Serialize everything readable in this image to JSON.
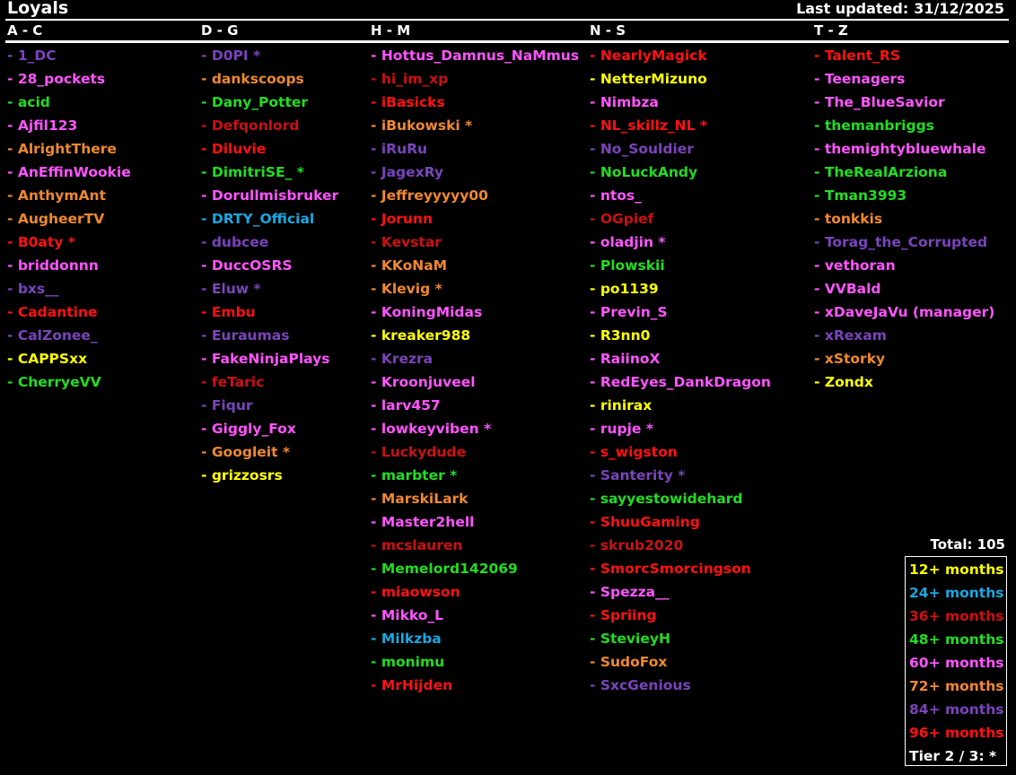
{
  "header": {
    "title": "Loyals",
    "last_updated_label": "Last updated:",
    "last_updated_date": "31/12/2025"
  },
  "colors": {
    "m12": "#ffff00",
    "m24": "#1aa7e0",
    "m36": "#cc1111",
    "m48": "#22dd22",
    "m60": "#ff55ff",
    "m72": "#f08830",
    "m84": "#7a44bb",
    "m96": "#ff1111"
  },
  "columns": [
    {
      "header": "A - C",
      "entries": [
        {
          "name": "- 1_DC",
          "tier": "m84"
        },
        {
          "name": "- 28_pockets",
          "tier": "m60"
        },
        {
          "name": "- acid",
          "tier": "m48"
        },
        {
          "name": "- Ajfil123",
          "tier": "m60"
        },
        {
          "name": "- AlrightThere",
          "tier": "m72"
        },
        {
          "name": "- AnEffinWookie",
          "tier": "m60"
        },
        {
          "name": "- AnthymAnt",
          "tier": "m72"
        },
        {
          "name": "- AugheerTV",
          "tier": "m72"
        },
        {
          "name": "- B0aty *",
          "tier": "m96"
        },
        {
          "name": "- briddonnn",
          "tier": "m60"
        },
        {
          "name": "- bxs__",
          "tier": "m84"
        },
        {
          "name": "- Cadantine",
          "tier": "m96"
        },
        {
          "name": "- CalZonee_",
          "tier": "m84"
        },
        {
          "name": "- CAPPSxx",
          "tier": "m12"
        },
        {
          "name": "- CherryeVV",
          "tier": "m48"
        }
      ]
    },
    {
      "header": "D - G",
      "entries": [
        {
          "name": "- D0PI *",
          "tier": "m84"
        },
        {
          "name": "- dankscoops",
          "tier": "m72"
        },
        {
          "name": "- Dany_Potter",
          "tier": "m48"
        },
        {
          "name": "- Defqonlord",
          "tier": "m36"
        },
        {
          "name": "- Diluvie",
          "tier": "m96"
        },
        {
          "name": "- DimitriSE_ *",
          "tier": "m48"
        },
        {
          "name": "- Dorullmisbruker",
          "tier": "m60"
        },
        {
          "name": "- DRTY_Official",
          "tier": "m24"
        },
        {
          "name": "- dubcee",
          "tier": "m84"
        },
        {
          "name": "- DuccOSRS",
          "tier": "m60"
        },
        {
          "name": "- Eluw *",
          "tier": "m84"
        },
        {
          "name": "- Embu",
          "tier": "m96"
        },
        {
          "name": "- Euraumas",
          "tier": "m84"
        },
        {
          "name": "- FakeNinjaPlays",
          "tier": "m60"
        },
        {
          "name": "- feTaric",
          "tier": "m36"
        },
        {
          "name": "- Fiqur",
          "tier": "m84"
        },
        {
          "name": "- Giggly_Fox",
          "tier": "m60"
        },
        {
          "name": "- Googleit *",
          "tier": "m72"
        },
        {
          "name": "- grizzosrs",
          "tier": "m12"
        }
      ]
    },
    {
      "header": "H - M",
      "entries": [
        {
          "name": "- Hottus_Damnus_NaMmus",
          "tier": "m60"
        },
        {
          "name": "- hi_im_xp",
          "tier": "m36"
        },
        {
          "name": "- iBasicks",
          "tier": "m96"
        },
        {
          "name": "- iBukowski *",
          "tier": "m72"
        },
        {
          "name": "- iRuRu",
          "tier": "m84"
        },
        {
          "name": "- JagexRy",
          "tier": "m84"
        },
        {
          "name": "- Jeffreyyyyy00",
          "tier": "m72"
        },
        {
          "name": "- Jorunn",
          "tier": "m96"
        },
        {
          "name": "- Kevstar",
          "tier": "m36"
        },
        {
          "name": "- KKoNaM",
          "tier": "m72"
        },
        {
          "name": "- Klevig *",
          "tier": "m72"
        },
        {
          "name": "- KoningMidas",
          "tier": "m60"
        },
        {
          "name": "- kreaker988",
          "tier": "m12"
        },
        {
          "name": "- Krezra",
          "tier": "m84"
        },
        {
          "name": "- Kroonjuveel",
          "tier": "m60"
        },
        {
          "name": "- larv457",
          "tier": "m60"
        },
        {
          "name": "- lowkeyviben *",
          "tier": "m60"
        },
        {
          "name": "- Luckydude",
          "tier": "m36"
        },
        {
          "name": "- marbter *",
          "tier": "m48"
        },
        {
          "name": "- MarskiLark",
          "tier": "m72"
        },
        {
          "name": "- Master2hell",
          "tier": "m60"
        },
        {
          "name": "- mcslauren",
          "tier": "m36"
        },
        {
          "name": "- Memelord142069",
          "tier": "m48"
        },
        {
          "name": "- miaowson",
          "tier": "m96"
        },
        {
          "name": "- Mikko_L",
          "tier": "m60"
        },
        {
          "name": "- Milkzba",
          "tier": "m24"
        },
        {
          "name": "- monimu",
          "tier": "m48"
        },
        {
          "name": "- MrHijden",
          "tier": "m96"
        }
      ]
    },
    {
      "header": "N - S",
      "entries": [
        {
          "name": "- NearlyMagick",
          "tier": "m96"
        },
        {
          "name": "- NetterMizuno",
          "tier": "m12"
        },
        {
          "name": "- Nimbza",
          "tier": "m60"
        },
        {
          "name": "- NL_skillz_NL *",
          "tier": "m96"
        },
        {
          "name": "- No_Souldier",
          "tier": "m84"
        },
        {
          "name": "- NoLuckAndy",
          "tier": "m48"
        },
        {
          "name": "- ntos_",
          "tier": "m60"
        },
        {
          "name": "- OGpief",
          "tier": "m36"
        },
        {
          "name": "- oladjin *",
          "tier": "m60"
        },
        {
          "name": "- Plowskii",
          "tier": "m48"
        },
        {
          "name": "- po1139",
          "tier": "m12"
        },
        {
          "name": "- Previn_S",
          "tier": "m60"
        },
        {
          "name": "- R3nn0",
          "tier": "m12"
        },
        {
          "name": "- RaiinoX",
          "tier": "m60"
        },
        {
          "name": "- RedEyes_DankDragon",
          "tier": "m60"
        },
        {
          "name": "- rinirax",
          "tier": "m12"
        },
        {
          "name": "- rupje *",
          "tier": "m60"
        },
        {
          "name": "- s_wigston",
          "tier": "m96"
        },
        {
          "name": "- Santerity *",
          "tier": "m84"
        },
        {
          "name": "- sayyestowidehard",
          "tier": "m48"
        },
        {
          "name": "- ShuuGaming",
          "tier": "m96"
        },
        {
          "name": "- skrub2020",
          "tier": "m36"
        },
        {
          "name": "- SmorcSmorcingson",
          "tier": "m96"
        },
        {
          "name": "- Spezza__",
          "tier": "m60"
        },
        {
          "name": "- Spriing",
          "tier": "m96"
        },
        {
          "name": "- StevieyH",
          "tier": "m48"
        },
        {
          "name": "- SudoFox",
          "tier": "m72"
        },
        {
          "name": "- SxcGenious",
          "tier": "m84"
        }
      ]
    },
    {
      "header": "T - Z",
      "entries": [
        {
          "name": "- Talent_RS",
          "tier": "m96"
        },
        {
          "name": "- Teenagers",
          "tier": "m60"
        },
        {
          "name": "- The_BlueSavior",
          "tier": "m60"
        },
        {
          "name": "- themanbriggs",
          "tier": "m48"
        },
        {
          "name": "- themightybluewhale",
          "tier": "m60"
        },
        {
          "name": "- TheRealArziona",
          "tier": "m48"
        },
        {
          "name": "- Tman3993",
          "tier": "m48"
        },
        {
          "name": "- tonkkis",
          "tier": "m72"
        },
        {
          "name": "- Torag_the_Corrupted",
          "tier": "m84"
        },
        {
          "name": "- vethoran",
          "tier": "m60"
        },
        {
          "name": "- VVBald",
          "tier": "m60"
        },
        {
          "name": "- xDaveJaVu (manager)",
          "tier": "m60"
        },
        {
          "name": "- xRexam",
          "tier": "m84"
        },
        {
          "name": "- xStorky",
          "tier": "m72"
        },
        {
          "name": "- Zondx",
          "tier": "m12"
        }
      ]
    }
  ],
  "total": "Total: 105",
  "legend": [
    {
      "label": "12+ months",
      "tier": "m12"
    },
    {
      "label": "24+ months",
      "tier": "m24"
    },
    {
      "label": "36+ months",
      "tier": "m36"
    },
    {
      "label": "48+ months",
      "tier": "m48"
    },
    {
      "label": "60+ months",
      "tier": "m60"
    },
    {
      "label": "72+ months",
      "tier": "m72"
    },
    {
      "label": "84+ months",
      "tier": "m84"
    },
    {
      "label": "96+ months",
      "tier": "m96"
    }
  ],
  "tier_note": "Tier 2 / 3: *"
}
